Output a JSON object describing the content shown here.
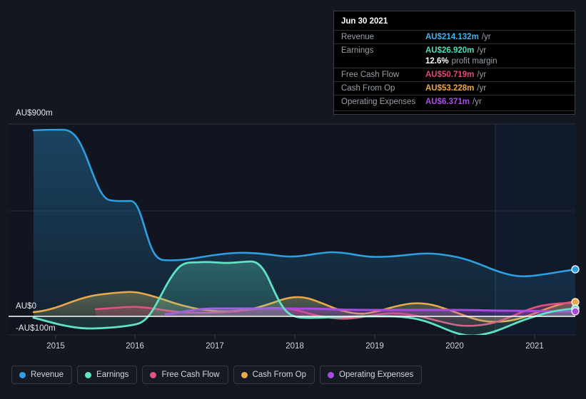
{
  "axis": {
    "y_top_label": "AU$900m",
    "y_zero_label": "AU$0",
    "y_neg_label": "-AU$100m",
    "x_ticks": [
      "2015",
      "2016",
      "2017",
      "2018",
      "2019",
      "2020",
      "2021"
    ]
  },
  "tooltip": {
    "title": "Jun 30 2021",
    "rows": [
      {
        "key": "Revenue",
        "value": "AU$214.132m",
        "suffix": "/yr",
        "color": "#3eb2ef"
      },
      {
        "key": "Earnings",
        "value": "AU$26.920m",
        "suffix": "/yr",
        "color": "#4ce0c0"
      },
      {
        "key": "",
        "value": "12.6%",
        "suffix": "profit margin",
        "color": "#ffffff"
      },
      {
        "key": "Free Cash Flow",
        "value": "AU$50.719m",
        "suffix": "/yr",
        "color": "#e8467c"
      },
      {
        "key": "Cash From Op",
        "value": "AU$53.228m",
        "suffix": "/yr",
        "color": "#f0a93c"
      },
      {
        "key": "Operating Expenses",
        "value": "AU$6.371m",
        "suffix": "/yr",
        "color": "#b14ce8"
      }
    ]
  },
  "legend": {
    "items": [
      {
        "label": "Revenue",
        "color": "#2e9fe0"
      },
      {
        "label": "Earnings",
        "color": "#5fe3c4"
      },
      {
        "label": "Free Cash Flow",
        "color": "#e0527f"
      },
      {
        "label": "Cash From Op",
        "color": "#eaa94a"
      },
      {
        "label": "Operating Expenses",
        "color": "#a94ae0"
      }
    ]
  },
  "colors": {
    "background": "#131720",
    "plot_background": "#101520",
    "plot_background_forecast": "#111827",
    "gridline": "#2b313c",
    "zero_line": "#ffffff",
    "revenue": "#2e9fe0",
    "earnings": "#5fe3c4",
    "free_cash_flow": "#e0527f",
    "cash_from_op": "#eaa94a",
    "operating_expenses": "#a94ae0"
  },
  "chart_data": {
    "type": "area",
    "title": "",
    "xlabel": "",
    "ylabel": "AU$",
    "ylim": [
      -100,
      900
    ],
    "xlim": [
      2014.6,
      2021.8
    ],
    "grid": true,
    "legend_position": "bottom",
    "currency": "AU$",
    "units": "millions",
    "y_gridlines": [
      900,
      450,
      0
    ],
    "zero_line": 0,
    "forecast_divider_x": 2020.55,
    "x": [
      2014.7,
      2015.0,
      2015.25,
      2015.5,
      2015.75,
      2016.0,
      2016.25,
      2016.5,
      2016.75,
      2017.0,
      2017.25,
      2017.5,
      2017.75,
      2018.0,
      2018.25,
      2018.5,
      2018.75,
      2019.0,
      2019.25,
      2019.5,
      2019.75,
      2020.0,
      2020.25,
      2020.5,
      2020.75,
      2021.0,
      2021.25,
      2021.5
    ],
    "series": [
      {
        "name": "Revenue",
        "color": "#2e9fe0",
        "values": [
          870,
          872,
          700,
          520,
          508,
          300,
          295,
          300,
          318,
          322,
          320,
          312,
          305,
          302,
          312,
          316,
          305,
          290,
          288,
          292,
          292,
          285,
          262,
          240,
          222,
          210,
          208,
          214
        ]
      },
      {
        "name": "Earnings",
        "color": "#5fe3c4",
        "values": [
          -8,
          -18,
          -33,
          -45,
          -52,
          -52,
          -50,
          -25,
          150,
          248,
          252,
          250,
          258,
          170,
          -10,
          -12,
          -10,
          -8,
          -6,
          -5,
          -8,
          -20,
          -55,
          -90,
          -100,
          -75,
          -42,
          27
        ]
      },
      {
        "name": "Free Cash Flow",
        "color": "#e0527f",
        "values": [
          null,
          null,
          20,
          25,
          26,
          27,
          24,
          18,
          12,
          12,
          12,
          16,
          20,
          22,
          14,
          2,
          -4,
          -6,
          -2,
          4,
          8,
          6,
          -2,
          -16,
          -28,
          -20,
          10,
          51
        ]
      },
      {
        "name": "Cash From Op",
        "color": "#eaa94a",
        "values": [
          22,
          24,
          38,
          52,
          58,
          56,
          50,
          40,
          30,
          24,
          22,
          26,
          36,
          45,
          40,
          28,
          16,
          10,
          14,
          22,
          30,
          34,
          30,
          18,
          4,
          2,
          22,
          53
        ]
      },
      {
        "name": "Operating Expenses",
        "color": "#a94ae0",
        "values": [
          null,
          null,
          null,
          null,
          null,
          null,
          4,
          6,
          8,
          9,
          9,
          9,
          9,
          9,
          9,
          9,
          8,
          8,
          8,
          8,
          8,
          8,
          8,
          8,
          7,
          7,
          7,
          6
        ]
      }
    ],
    "endpoints": [
      {
        "name": "Revenue",
        "x": 2021.5,
        "y": 214,
        "color": "#2e9fe0"
      },
      {
        "name": "Cash From Op",
        "x": 2021.5,
        "y": 53,
        "color": "#eaa94a"
      },
      {
        "name": "Earnings",
        "x": 2021.5,
        "y": 27,
        "color": "#5fe3c4"
      },
      {
        "name": "Operating Expenses",
        "x": 2021.5,
        "y": 6,
        "color": "#a94ae0"
      }
    ]
  }
}
